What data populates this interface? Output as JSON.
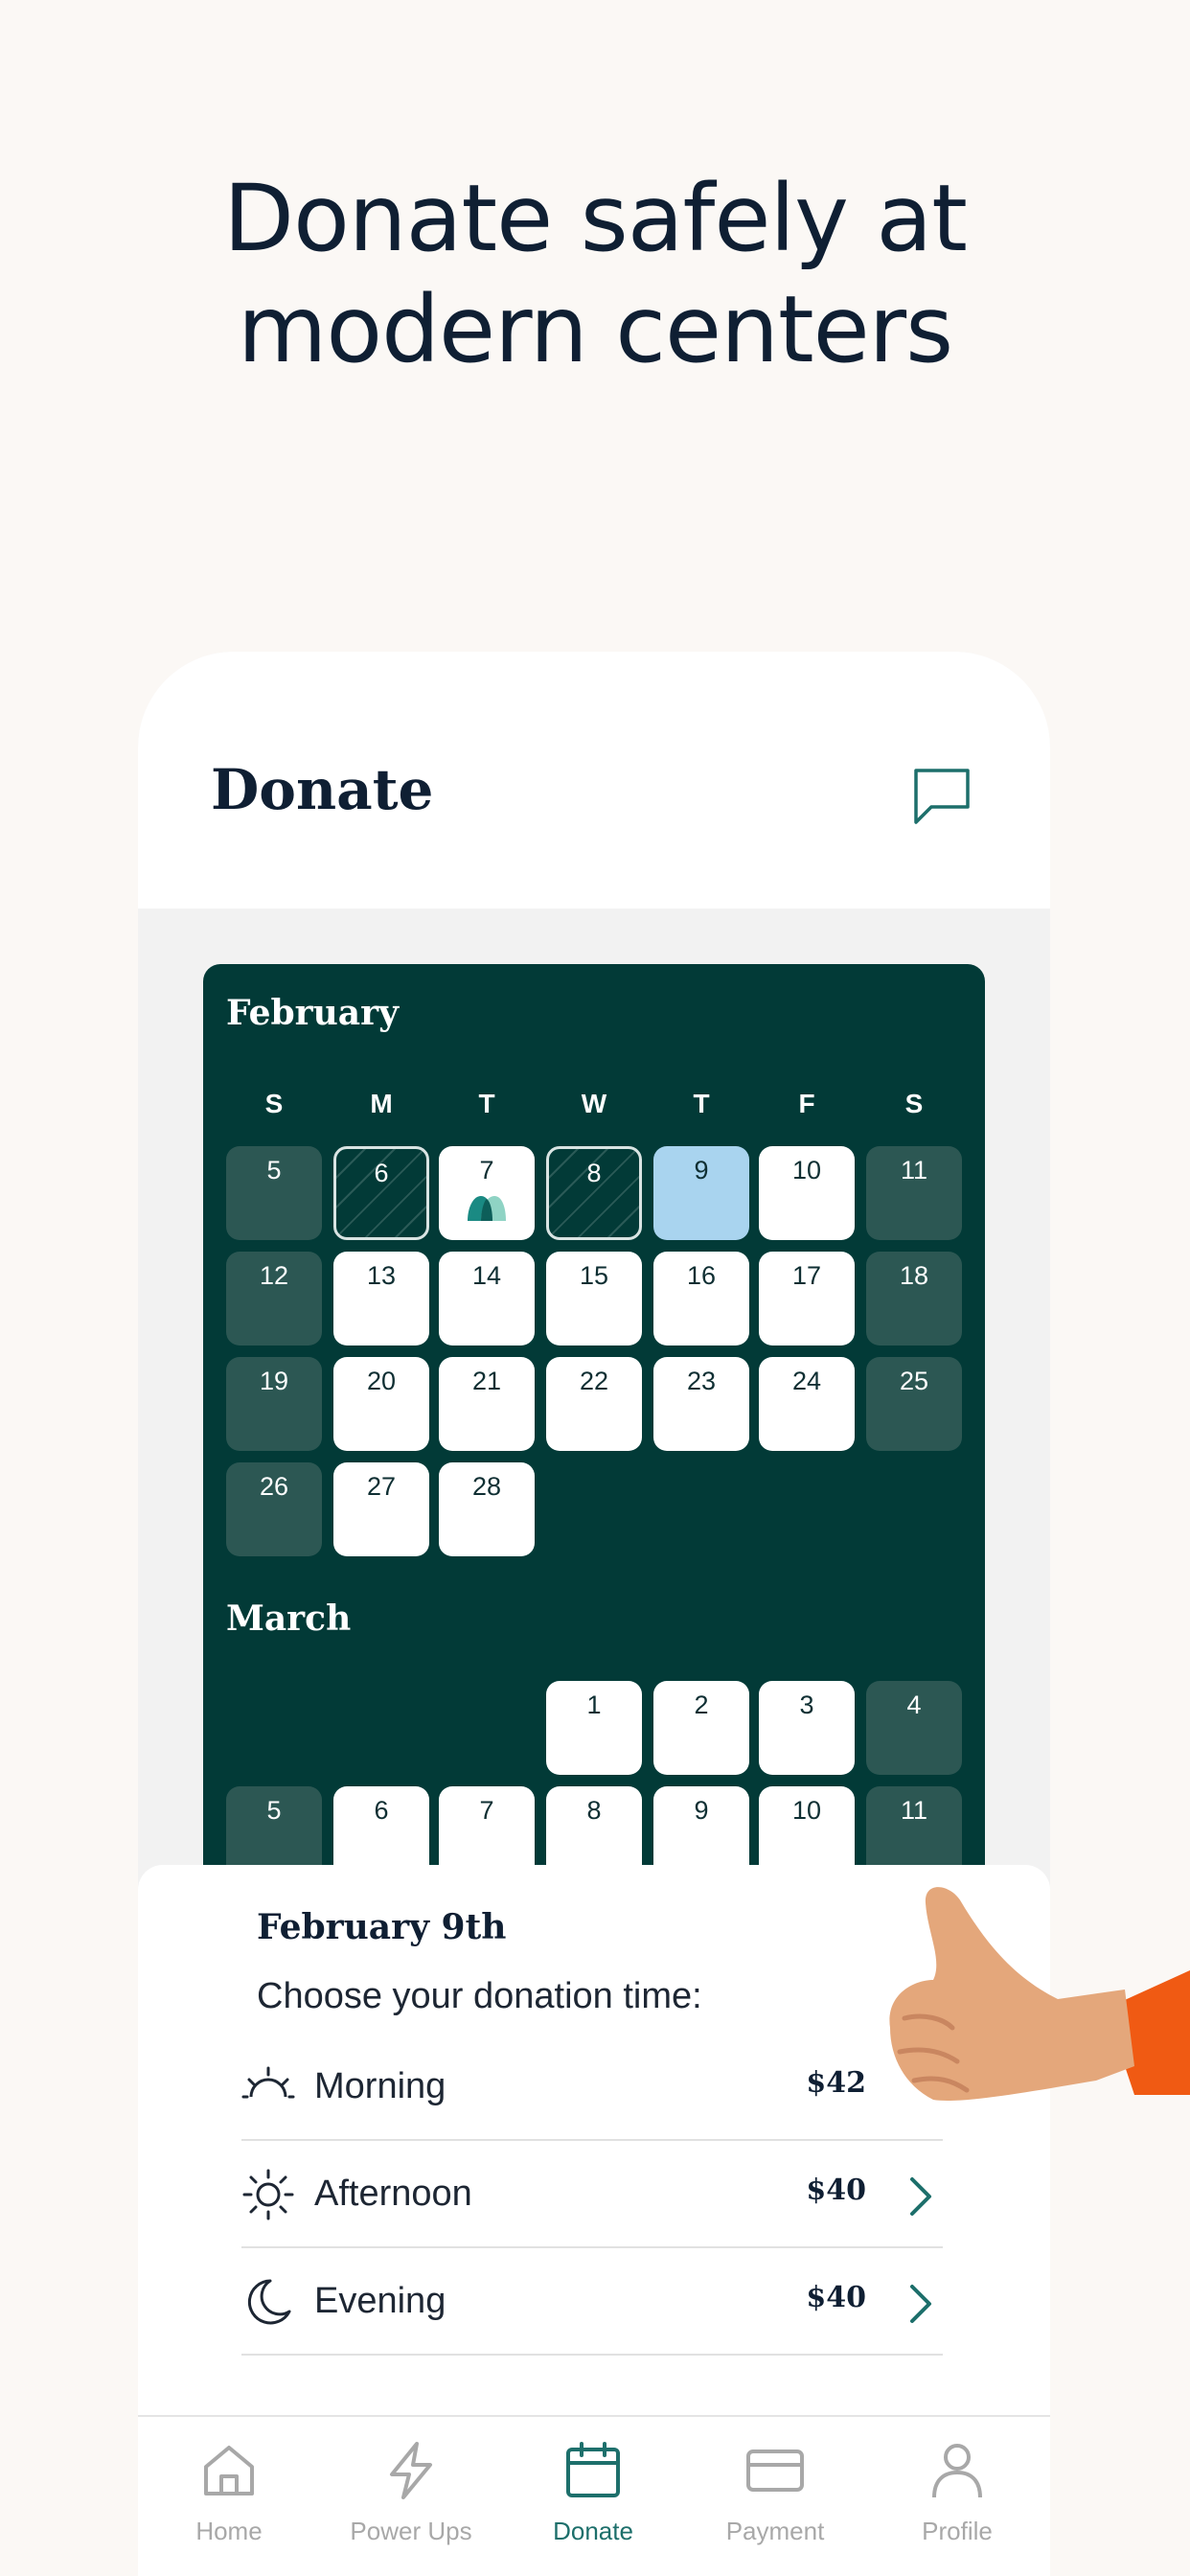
{
  "headline": {
    "line1": "Donate safely at",
    "line2": "modern centers"
  },
  "header": {
    "title": "Donate",
    "chat_icon": "chat-bubble-icon"
  },
  "calendar": {
    "weekdays": [
      "S",
      "M",
      "T",
      "W",
      "T",
      "F",
      "S"
    ],
    "months": [
      {
        "name": "February",
        "weeks": [
          [
            {
              "day": "5",
              "state": "weekend"
            },
            {
              "day": "6",
              "state": "hatched"
            },
            {
              "day": "7",
              "state": "white",
              "marker": "drop-icon"
            },
            {
              "day": "8",
              "state": "hatched"
            },
            {
              "day": "9",
              "state": "selected"
            },
            {
              "day": "10",
              "state": "white"
            },
            {
              "day": "11",
              "state": "weekend"
            }
          ],
          [
            {
              "day": "12",
              "state": "weekend"
            },
            {
              "day": "13",
              "state": "white"
            },
            {
              "day": "14",
              "state": "white"
            },
            {
              "day": "15",
              "state": "white"
            },
            {
              "day": "16",
              "state": "white"
            },
            {
              "day": "17",
              "state": "white"
            },
            {
              "day": "18",
              "state": "weekend"
            }
          ],
          [
            {
              "day": "19",
              "state": "weekend"
            },
            {
              "day": "20",
              "state": "white"
            },
            {
              "day": "21",
              "state": "white"
            },
            {
              "day": "22",
              "state": "white"
            },
            {
              "day": "23",
              "state": "white"
            },
            {
              "day": "24",
              "state": "white"
            },
            {
              "day": "25",
              "state": "weekend"
            }
          ],
          [
            {
              "day": "26",
              "state": "weekend"
            },
            {
              "day": "27",
              "state": "white"
            },
            {
              "day": "28",
              "state": "white"
            }
          ]
        ]
      },
      {
        "name": "March",
        "weeks": [
          [
            null,
            null,
            null,
            {
              "day": "1",
              "state": "white"
            },
            {
              "day": "2",
              "state": "white"
            },
            {
              "day": "3",
              "state": "white"
            },
            {
              "day": "4",
              "state": "weekend"
            }
          ],
          [
            {
              "day": "5",
              "state": "weekend"
            },
            {
              "day": "6",
              "state": "white"
            },
            {
              "day": "7",
              "state": "white"
            },
            {
              "day": "8",
              "state": "white"
            },
            {
              "day": "9",
              "state": "white"
            },
            {
              "day": "10",
              "state": "white"
            },
            {
              "day": "11",
              "state": "weekend"
            }
          ]
        ]
      }
    ]
  },
  "sheet": {
    "date": "February 9th",
    "subtitle": "Choose your donation time:",
    "slots": [
      {
        "label": "Morning",
        "price": "$42",
        "icon": "sunrise-icon"
      },
      {
        "label": "Afternoon",
        "price": "$40",
        "icon": "sun-icon"
      },
      {
        "label": "Evening",
        "price": "$40",
        "icon": "moon-icon"
      }
    ]
  },
  "tabs": [
    {
      "label": "Home",
      "icon": "home-icon",
      "active": false
    },
    {
      "label": "Power Ups",
      "icon": "lightning-icon",
      "active": false
    },
    {
      "label": "Donate",
      "icon": "calendar-icon",
      "active": true
    },
    {
      "label": "Payment",
      "icon": "credit-card-icon",
      "active": false
    },
    {
      "label": "Profile",
      "icon": "person-icon",
      "active": false
    }
  ],
  "colors": {
    "accent": "#1d6f6b",
    "calendar_bg": "#023a37",
    "weekend_cell": "#2c5753",
    "selected_cell": "#a9d4ef",
    "page_bg": "#fbf8f5"
  }
}
